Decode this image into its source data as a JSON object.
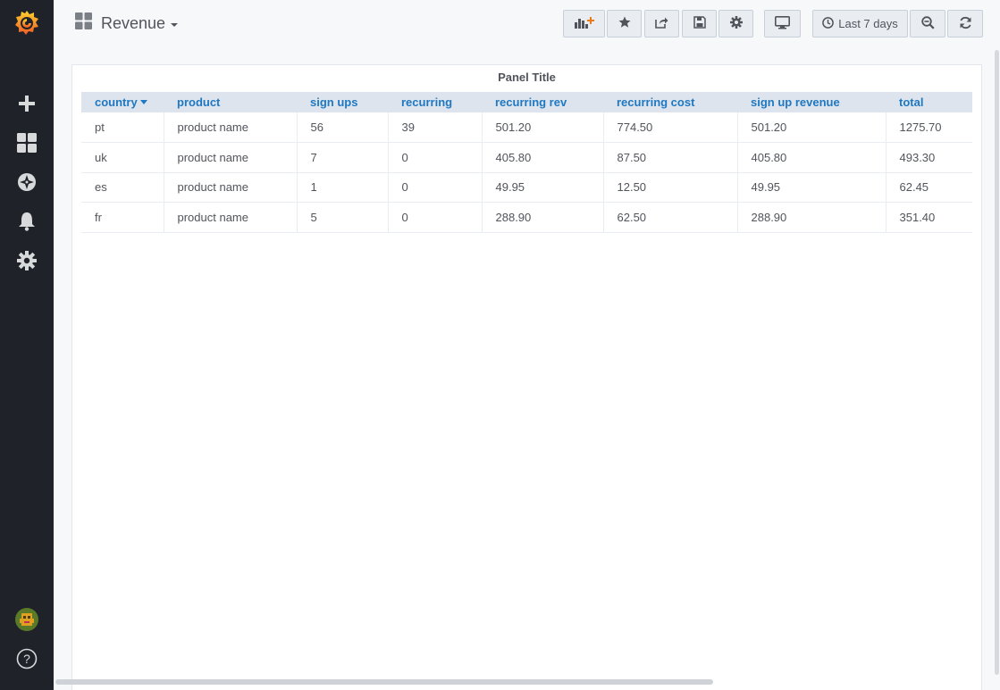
{
  "sidebar": {
    "items": [
      {
        "icon": "grafana-logo-icon"
      },
      {
        "icon": "plus-icon"
      },
      {
        "icon": "dashboards-grid-icon"
      },
      {
        "icon": "compass-explore-icon"
      },
      {
        "icon": "bell-alerting-icon"
      },
      {
        "icon": "gear-configuration-icon"
      },
      {
        "icon": "user-avatar-icon"
      },
      {
        "icon": "help-question-icon"
      }
    ],
    "help_glyph": "?"
  },
  "header": {
    "dashboard_title": "Revenue",
    "time_range_label": "Last 7 days",
    "buttons": [
      {
        "icon": "add-panel-icon"
      },
      {
        "icon": "star-icon"
      },
      {
        "icon": "share-icon"
      },
      {
        "icon": "save-icon"
      },
      {
        "icon": "settings-gear-icon"
      },
      {
        "icon": "monitor-view-mode-icon"
      },
      {
        "icon": "zoom-out-icon"
      },
      {
        "icon": "refresh-icon"
      }
    ]
  },
  "panel": {
    "title": "Panel Title",
    "table": {
      "columns": [
        "country",
        "product",
        "sign ups",
        "recurring",
        "recurring rev",
        "recurring cost",
        "sign up revenue",
        "total"
      ],
      "sort_column": "country",
      "rows": [
        [
          "pt",
          "product name",
          "56",
          "39",
          "501.20",
          "774.50",
          "501.20",
          "1275.70"
        ],
        [
          "uk",
          "product name",
          "7",
          "0",
          "405.80",
          "87.50",
          "405.80",
          "493.30"
        ],
        [
          "es",
          "product name",
          "1",
          "0",
          "49.95",
          "12.50",
          "49.95",
          "62.45"
        ],
        [
          "fr",
          "product name",
          "5",
          "0",
          "288.90",
          "62.50",
          "288.90",
          "351.40"
        ]
      ]
    }
  },
  "colors": {
    "sidebar_bg": "#1f2329",
    "header_text": "#1f78c1",
    "logo_orange": "#f46800",
    "add_panel_accent": "#eb7b18"
  }
}
